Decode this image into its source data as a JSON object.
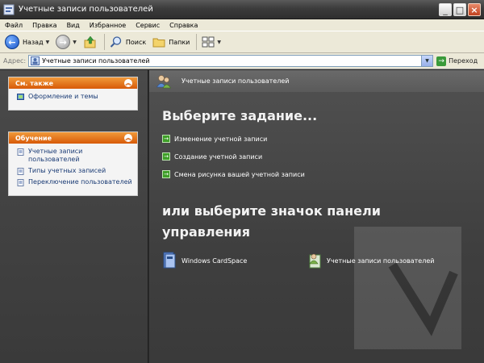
{
  "window": {
    "title": "Учетные записи пользователей"
  },
  "menu": [
    "Файл",
    "Правка",
    "Вид",
    "Избранное",
    "Сервис",
    "Справка"
  ],
  "toolbar": {
    "back_label": "Назад",
    "search_label": "Поиск",
    "folders_label": "Папки"
  },
  "address": {
    "label": "Адрес:",
    "value": "Учетные записи пользователей",
    "go_label": "Переход"
  },
  "sidebar": {
    "see_also": {
      "title": "См. также",
      "items": [
        "Оформление и темы"
      ]
    },
    "learn": {
      "title": "Обучение",
      "items": [
        "Учетные записи пользователей",
        "Типы учетных записей",
        "Переключение пользователей"
      ]
    }
  },
  "main": {
    "banner_title": "Учетные записи пользователей",
    "heading": "Выберите задание...",
    "tasks": [
      "Изменение учетной записи",
      "Создание учетной записи",
      "Смена рисунка вашей учетной записи"
    ],
    "heading2": "или выберите значок панели управления",
    "icons": [
      "Windows CardSpace",
      "Учетные записи пользователей"
    ]
  }
}
